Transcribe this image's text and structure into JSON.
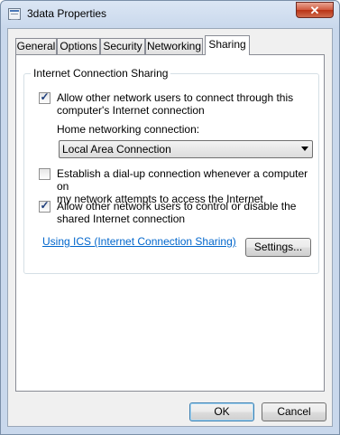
{
  "window": {
    "title": "3data Properties",
    "close_glyph": "✕",
    "icon": "network-connection-icon"
  },
  "tabs": [
    {
      "label": "General"
    },
    {
      "label": "Options"
    },
    {
      "label": "Security"
    },
    {
      "label": "Networking"
    },
    {
      "label": "Sharing",
      "selected": true
    }
  ],
  "sharing": {
    "group_label": "Internet Connection Sharing",
    "allow_connect": {
      "line1": "Allow other network users to connect through this",
      "line2": "computer's Internet connection",
      "checked": true
    },
    "home_label": "Home networking connection:",
    "home_value": "Local Area Connection",
    "dialup": {
      "line1": "Establish a dial-up connection whenever a computer on",
      "line2": "my network attempts to access the Internet",
      "checked": false
    },
    "allow_control": {
      "line1": "Allow other network users to control or disable the",
      "line2": "shared Internet connection",
      "checked": true
    },
    "link": "Using ICS (Internet Connection Sharing)",
    "settings_button": "Settings..."
  },
  "footer": {
    "ok": "OK",
    "cancel": "Cancel"
  },
  "colors": {
    "link": "#0066cc",
    "close": "#c94a2e"
  }
}
